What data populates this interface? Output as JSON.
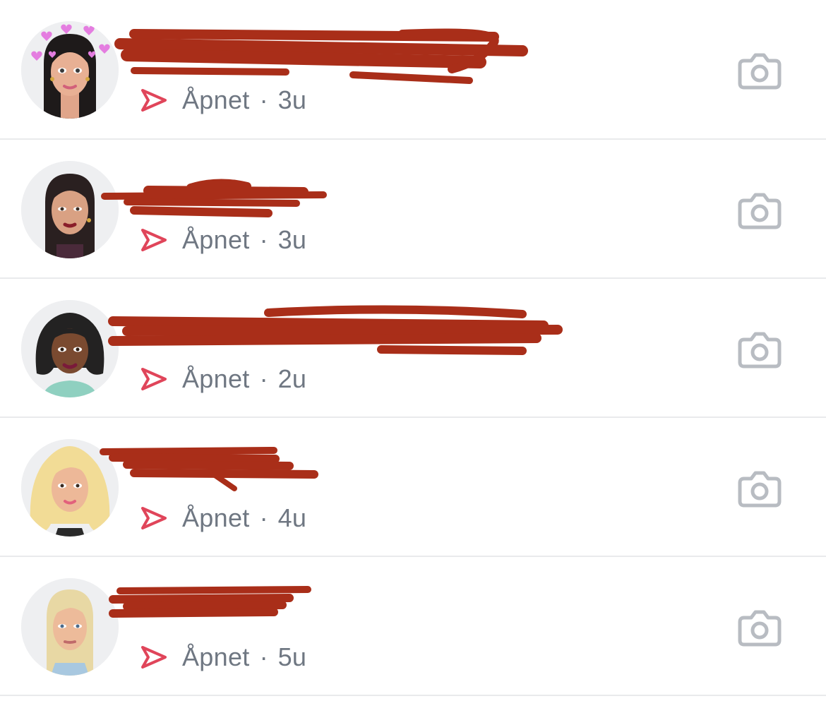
{
  "chats": [
    {
      "avatar_variant": "dark-hair-hearts",
      "name": "",
      "status": "Åpnet",
      "time": "3u",
      "send_icon": "send-arrow-icon",
      "action_icon": "camera-icon"
    },
    {
      "avatar_variant": "dark-hair",
      "name": "",
      "status": "Åpnet",
      "time": "3u",
      "send_icon": "send-arrow-icon",
      "action_icon": "camera-icon"
    },
    {
      "avatar_variant": "dark-skin-bob",
      "name": "",
      "status": "Åpnet",
      "time": "2u",
      "send_icon": "send-arrow-icon",
      "action_icon": "camera-icon"
    },
    {
      "avatar_variant": "blonde-wavy",
      "name": "",
      "status": "Åpnet",
      "time": "4u",
      "send_icon": "send-arrow-icon",
      "action_icon": "camera-icon"
    },
    {
      "avatar_variant": "blonde-halo",
      "name": "",
      "status": "Åpnet",
      "time": "5u",
      "send_icon": "send-arrow-icon",
      "action_icon": "camera-icon"
    }
  ],
  "colors": {
    "status_text": "#6f7782",
    "send_arrow": "#e0455a",
    "camera_icon": "#b8bcc2",
    "redaction": "#a92e19",
    "divider": "#e9eaec"
  }
}
